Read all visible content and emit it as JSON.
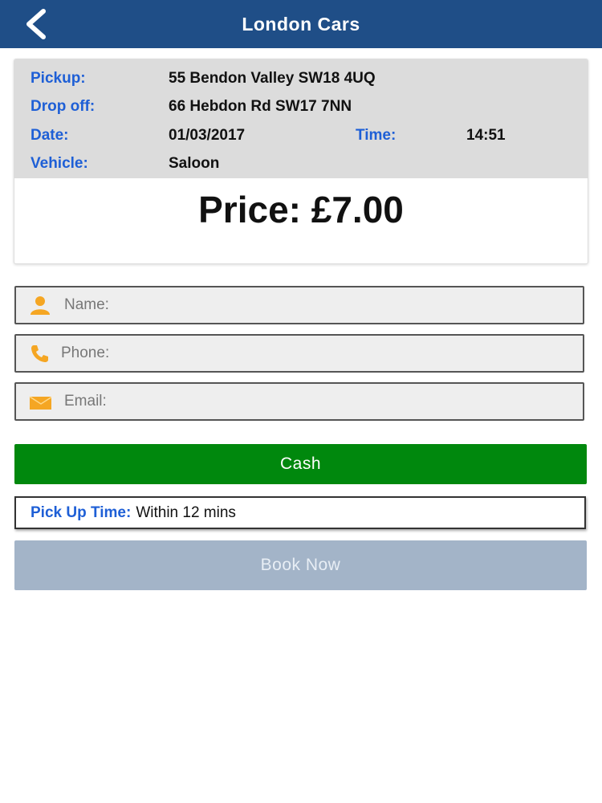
{
  "header": {
    "title": "London Cars",
    "back_icon": "chevron-left-icon"
  },
  "summary": {
    "pickup_label": "Pickup:",
    "pickup_value": "55 Bendon Valley SW18 4UQ",
    "dropoff_label": "Drop off:",
    "dropoff_value": "66 Hebdon Rd SW17 7NN",
    "date_label": "Date:",
    "date_value": "01/03/2017",
    "time_label": "Time:",
    "time_value": "14:51",
    "vehicle_label": "Vehicle:",
    "vehicle_value": "Saloon",
    "price": "Price: £7.00"
  },
  "form": {
    "name_placeholder": "Name:",
    "name_value": "",
    "phone_placeholder": "Phone:",
    "phone_value": "",
    "email_placeholder": "Email:",
    "email_value": "",
    "icons": [
      "person-icon",
      "phone-icon",
      "envelope-icon"
    ]
  },
  "payment": {
    "cash_label": "Cash"
  },
  "pickup_time": {
    "label": "Pick Up Time:",
    "value": "Within 12 mins"
  },
  "actions": {
    "book_now_label": "Book Now"
  },
  "colors": {
    "header_bg": "#1f4e87",
    "label_blue": "#1e5fd6",
    "cash_green": "#00880d",
    "book_disabled": "#a3b4c8",
    "icon_orange": "#f5a623"
  }
}
